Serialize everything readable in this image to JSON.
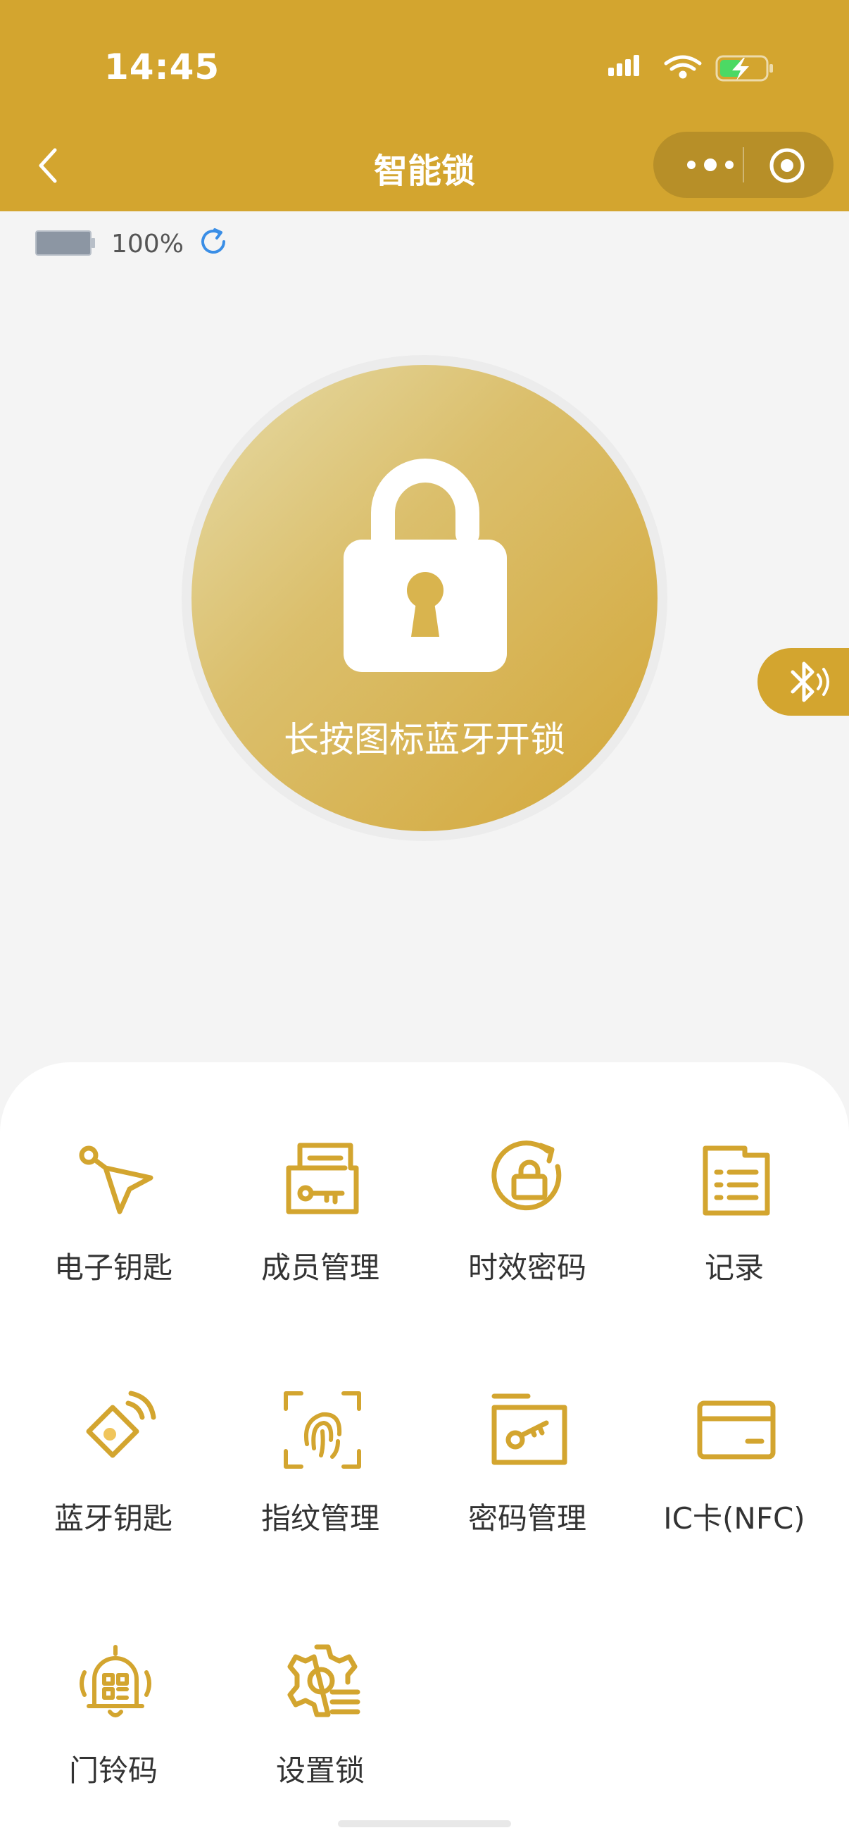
{
  "status_bar": {
    "time": "14:45"
  },
  "nav": {
    "title": "智能锁"
  },
  "battery": {
    "level_percent": 100,
    "text": "100%"
  },
  "unlock": {
    "label": "长按图标蓝牙开锁"
  },
  "menu": {
    "items": [
      {
        "label": "电子钥匙",
        "icon": "cursor-key-icon"
      },
      {
        "label": "成员管理",
        "icon": "folder-key-icon"
      },
      {
        "label": "时效密码",
        "icon": "timed-lock-icon"
      },
      {
        "label": "记录",
        "icon": "list-record-icon"
      },
      {
        "label": "蓝牙钥匙",
        "icon": "bluetooth-key-icon"
      },
      {
        "label": "指纹管理",
        "icon": "fingerprint-icon"
      },
      {
        "label": "密码管理",
        "icon": "password-key-icon"
      },
      {
        "label": "IC卡(NFC)",
        "icon": "card-icon"
      },
      {
        "label": "门铃码",
        "icon": "doorbell-qr-icon"
      },
      {
        "label": "设置锁",
        "icon": "settings-gear-icon"
      }
    ]
  },
  "colors": {
    "accent": "#d3a52f",
    "background": "#f4f4f4",
    "text": "#333333"
  }
}
